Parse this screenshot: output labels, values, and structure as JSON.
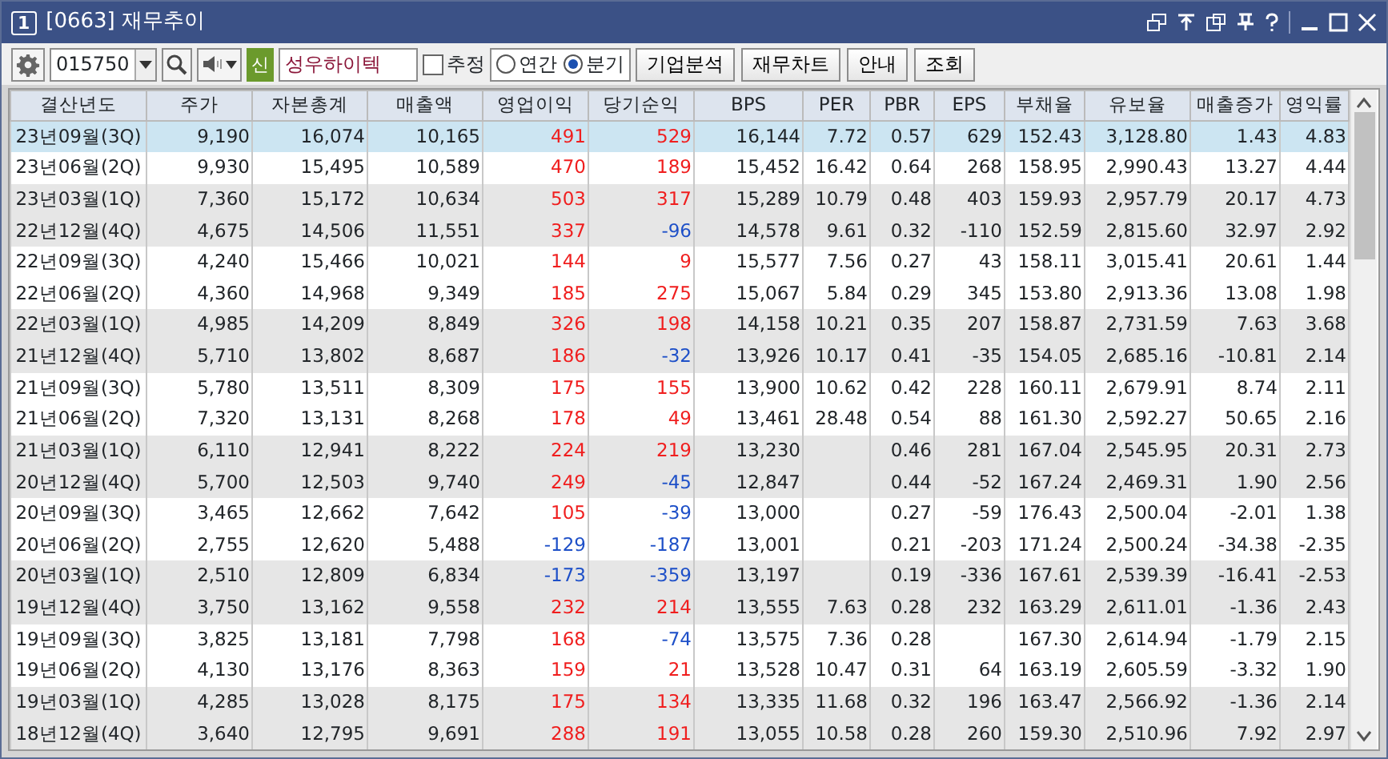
{
  "window": {
    "badge": "1",
    "title": "[0663]  재무추이"
  },
  "toolbar": {
    "stock_code": "015750",
    "market_tag": "신",
    "stock_name": "성우하이텍",
    "estimate": {
      "label": "추정",
      "checked": false
    },
    "period": [
      {
        "label": "연간",
        "selected": false
      },
      {
        "label": "분기",
        "selected": true
      }
    ],
    "buttons": [
      "기업분석",
      "재무차트",
      "안내",
      "조회"
    ]
  },
  "table": {
    "columns": [
      "결산년도",
      "주가",
      "자본총계",
      "매출액",
      "영업이익",
      "당기순익",
      "BPS",
      "PER",
      "PBR",
      "EPS",
      "부채율",
      "유보율",
      "매출증가",
      "영익률"
    ],
    "rows": [
      {
        "selected": true,
        "cells": [
          "23년09월(3Q)",
          "9,190",
          "16,074",
          "10,165",
          {
            "text": "491",
            "color": "#f01e1e"
          },
          {
            "text": "529",
            "color": "#f01e1e"
          },
          "16,144",
          "7.72",
          "0.57",
          "629",
          "152.43",
          "3,128.80",
          "1.43",
          "4.83"
        ]
      },
      {
        "selected": false,
        "cells": [
          "23년06월(2Q)",
          "9,930",
          "15,495",
          "10,589",
          {
            "text": "470",
            "color": "#f01e1e"
          },
          {
            "text": "189",
            "color": "#f01e1e"
          },
          "15,452",
          "16.42",
          "0.64",
          "268",
          "158.95",
          "2,990.43",
          "13.27",
          "4.44"
        ]
      },
      {
        "selected": false,
        "cells": [
          "23년03월(1Q)",
          "7,360",
          "15,172",
          "10,634",
          {
            "text": "503",
            "color": "#f01e1e"
          },
          {
            "text": "317",
            "color": "#f01e1e"
          },
          "15,289",
          "10.79",
          "0.48",
          "403",
          "159.93",
          "2,957.79",
          "20.17",
          "4.73"
        ]
      },
      {
        "selected": false,
        "cells": [
          "22년12월(4Q)",
          "4,675",
          "14,506",
          "11,551",
          {
            "text": "337",
            "color": "#f01e1e"
          },
          {
            "text": "-96",
            "color": "#1e50c8"
          },
          "14,578",
          "9.61",
          "0.32",
          "-110",
          "152.59",
          "2,815.60",
          "32.97",
          "2.92"
        ]
      },
      {
        "selected": false,
        "cells": [
          "22년09월(3Q)",
          "4,240",
          "15,466",
          "10,021",
          {
            "text": "144",
            "color": "#f01e1e"
          },
          {
            "text": "9",
            "color": "#f01e1e"
          },
          "15,577",
          "7.56",
          "0.27",
          "43",
          "158.11",
          "3,015.41",
          "20.61",
          "1.44"
        ]
      },
      {
        "selected": false,
        "cells": [
          "22년06월(2Q)",
          "4,360",
          "14,968",
          "9,349",
          {
            "text": "185",
            "color": "#f01e1e"
          },
          {
            "text": "275",
            "color": "#f01e1e"
          },
          "15,067",
          "5.84",
          "0.29",
          "345",
          "153.80",
          "2,913.36",
          "13.08",
          "1.98"
        ]
      },
      {
        "selected": false,
        "cells": [
          "22년03월(1Q)",
          "4,985",
          "14,209",
          "8,849",
          {
            "text": "326",
            "color": "#f01e1e"
          },
          {
            "text": "198",
            "color": "#f01e1e"
          },
          "14,158",
          "10.21",
          "0.35",
          "207",
          "158.87",
          "2,731.59",
          "7.63",
          "3.68"
        ]
      },
      {
        "selected": false,
        "cells": [
          "21년12월(4Q)",
          "5,710",
          "13,802",
          "8,687",
          {
            "text": "186",
            "color": "#f01e1e"
          },
          {
            "text": "-32",
            "color": "#1e50c8"
          },
          "13,926",
          "10.17",
          "0.41",
          "-35",
          "154.05",
          "2,685.16",
          "-10.81",
          "2.14"
        ]
      },
      {
        "selected": false,
        "cells": [
          "21년09월(3Q)",
          "5,780",
          "13,511",
          "8,309",
          {
            "text": "175",
            "color": "#f01e1e"
          },
          {
            "text": "155",
            "color": "#f01e1e"
          },
          "13,900",
          "10.62",
          "0.42",
          "228",
          "160.11",
          "2,679.91",
          "8.74",
          "2.11"
        ]
      },
      {
        "selected": false,
        "cells": [
          "21년06월(2Q)",
          "7,320",
          "13,131",
          "8,268",
          {
            "text": "178",
            "color": "#f01e1e"
          },
          {
            "text": "49",
            "color": "#f01e1e"
          },
          "13,461",
          "28.48",
          "0.54",
          "88",
          "161.30",
          "2,592.27",
          "50.65",
          "2.16"
        ]
      },
      {
        "selected": false,
        "cells": [
          "21년03월(1Q)",
          "6,110",
          "12,941",
          "8,222",
          {
            "text": "224",
            "color": "#f01e1e"
          },
          {
            "text": "219",
            "color": "#f01e1e"
          },
          "13,230",
          "",
          "0.46",
          "281",
          "167.04",
          "2,545.95",
          "20.31",
          "2.73"
        ]
      },
      {
        "selected": false,
        "cells": [
          "20년12월(4Q)",
          "5,700",
          "12,503",
          "9,740",
          {
            "text": "249",
            "color": "#f01e1e"
          },
          {
            "text": "-45",
            "color": "#1e50c8"
          },
          "12,847",
          "",
          "0.44",
          "-52",
          "167.24",
          "2,469.31",
          "1.90",
          "2.56"
        ]
      },
      {
        "selected": false,
        "cells": [
          "20년09월(3Q)",
          "3,465",
          "12,662",
          "7,642",
          {
            "text": "105",
            "color": "#f01e1e"
          },
          {
            "text": "-39",
            "color": "#1e50c8"
          },
          "13,000",
          "",
          "0.27",
          "-59",
          "176.43",
          "2,500.04",
          "-2.01",
          "1.38"
        ]
      },
      {
        "selected": false,
        "cells": [
          "20년06월(2Q)",
          "2,755",
          "12,620",
          "5,488",
          {
            "text": "-129",
            "color": "#1e50c8"
          },
          {
            "text": "-187",
            "color": "#1e50c8"
          },
          "13,001",
          "",
          "0.21",
          "-203",
          "171.24",
          "2,500.24",
          "-34.38",
          "-2.35"
        ]
      },
      {
        "selected": false,
        "cells": [
          "20년03월(1Q)",
          "2,510",
          "12,809",
          "6,834",
          {
            "text": "-173",
            "color": "#1e50c8"
          },
          {
            "text": "-359",
            "color": "#1e50c8"
          },
          "13,197",
          "",
          "0.19",
          "-336",
          "167.61",
          "2,539.39",
          "-16.41",
          "-2.53"
        ]
      },
      {
        "selected": false,
        "cells": [
          "19년12월(4Q)",
          "3,750",
          "13,162",
          "9,558",
          {
            "text": "232",
            "color": "#f01e1e"
          },
          {
            "text": "214",
            "color": "#f01e1e"
          },
          "13,555",
          "7.63",
          "0.28",
          "232",
          "163.29",
          "2,611.01",
          "-1.36",
          "2.43"
        ]
      },
      {
        "selected": false,
        "cells": [
          "19년09월(3Q)",
          "3,825",
          "13,181",
          "7,798",
          {
            "text": "168",
            "color": "#f01e1e"
          },
          {
            "text": "-74",
            "color": "#1e50c8"
          },
          "13,575",
          "7.36",
          "0.28",
          "",
          "167.30",
          "2,614.94",
          "-1.79",
          "2.15"
        ]
      },
      {
        "selected": false,
        "cells": [
          "19년06월(2Q)",
          "4,130",
          "13,176",
          "8,363",
          {
            "text": "159",
            "color": "#f01e1e"
          },
          {
            "text": "21",
            "color": "#f01e1e"
          },
          "13,528",
          "10.47",
          "0.31",
          "64",
          "163.19",
          "2,605.59",
          "-3.32",
          "1.90"
        ]
      },
      {
        "selected": false,
        "cells": [
          "19년03월(1Q)",
          "4,285",
          "13,028",
          "8,175",
          {
            "text": "175",
            "color": "#f01e1e"
          },
          {
            "text": "134",
            "color": "#f01e1e"
          },
          "13,335",
          "11.68",
          "0.32",
          "196",
          "163.47",
          "2,566.92",
          "-1.36",
          "2.14"
        ]
      },
      {
        "selected": false,
        "cells": [
          "18년12월(4Q)",
          "3,640",
          "12,795",
          "9,691",
          {
            "text": "288",
            "color": "#f01e1e"
          },
          {
            "text": "191",
            "color": "#f01e1e"
          },
          "13,055",
          "10.58",
          "0.28",
          "260",
          "159.30",
          "2,510.96",
          "7.92",
          "2.97"
        ]
      }
    ]
  }
}
